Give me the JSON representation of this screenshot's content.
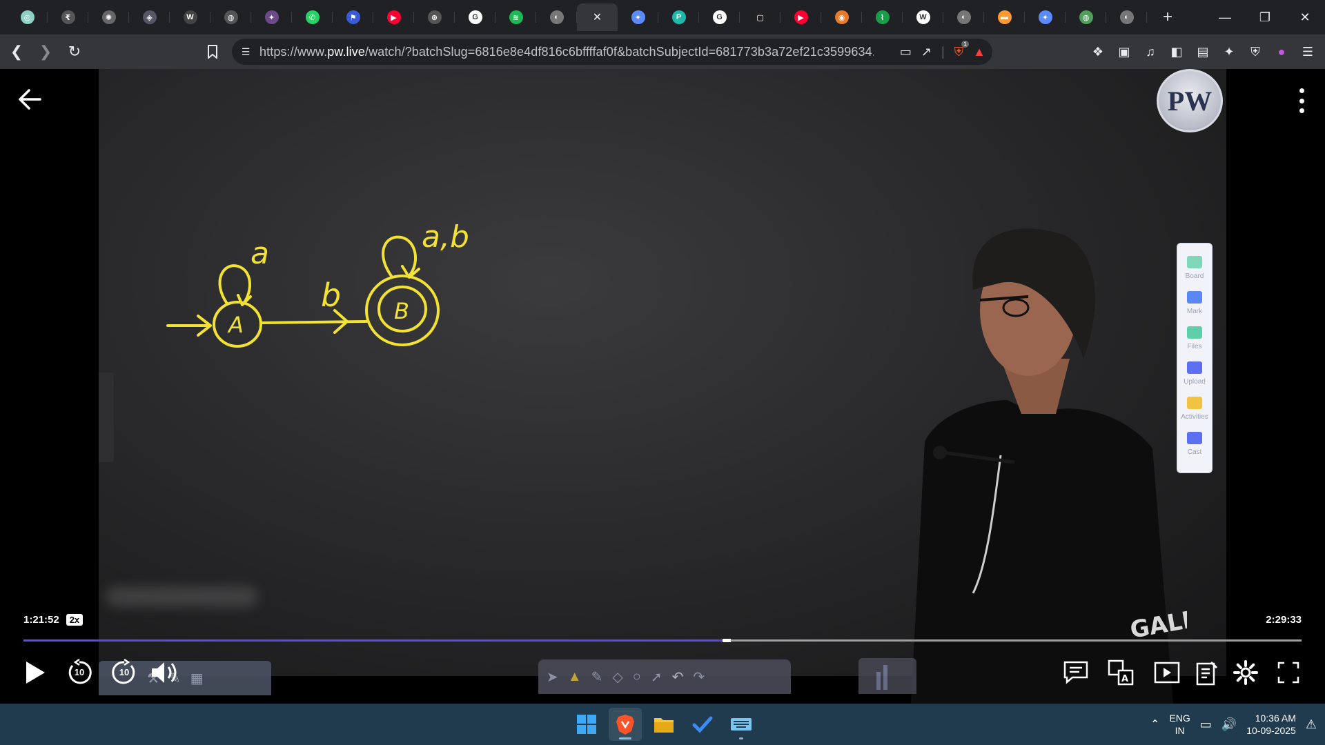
{
  "browser": {
    "tabs": [
      {
        "icon": "chatgpt-icon",
        "color": "#8fd0c4",
        "glyph": "◎"
      },
      {
        "icon": "coin-icon",
        "color": "#555",
        "glyph": "₹"
      },
      {
        "icon": "openai-icon",
        "color": "#666",
        "glyph": "✺"
      },
      {
        "icon": "game-icon",
        "color": "#556",
        "glyph": "◈"
      },
      {
        "icon": "wordpress-icon",
        "color": "#444",
        "glyph": "W"
      },
      {
        "icon": "grey-circle-icon",
        "color": "#555",
        "glyph": "◍"
      },
      {
        "icon": "purple-app-icon",
        "color": "#6b4a8a",
        "glyph": "✦"
      },
      {
        "icon": "whatsapp-icon",
        "color": "#25d366",
        "glyph": "✆"
      },
      {
        "icon": "bookmark-app-icon",
        "color": "#3b5bd6",
        "glyph": "⚑"
      },
      {
        "icon": "youtube-icon",
        "color": "#ff0033",
        "glyph": "▶"
      },
      {
        "icon": "nptel-icon",
        "color": "#555",
        "glyph": "⊛"
      },
      {
        "icon": "google-icon",
        "color": "#ffffff",
        "glyph": "G"
      },
      {
        "icon": "spotify-icon",
        "color": "#1db954",
        "glyph": "≋"
      },
      {
        "icon": "globe-icon",
        "color": "#777",
        "glyph": "◐"
      },
      {
        "icon": "active-tab-close-icon",
        "color": "",
        "glyph": "✕",
        "active": true
      },
      {
        "icon": "gemini-icon",
        "color": "#5b8cff",
        "glyph": "✦"
      },
      {
        "icon": "perplexity-icon",
        "color": "#20b8a8",
        "glyph": "P"
      },
      {
        "icon": "google-icon",
        "color": "#ffffff",
        "glyph": "G"
      },
      {
        "icon": "screen-icon",
        "color": "#222",
        "glyph": "▢"
      },
      {
        "icon": "youtube-icon",
        "color": "#ff0033",
        "glyph": "▶"
      },
      {
        "icon": "orange-globe-icon",
        "color": "#e87b2b",
        "glyph": "◉"
      },
      {
        "icon": "chart-app-icon",
        "color": "#1a9d4a",
        "glyph": "⌇"
      },
      {
        "icon": "wikipedia-icon",
        "color": "#ffffff",
        "glyph": "W"
      },
      {
        "icon": "globe-icon",
        "color": "#777",
        "glyph": "◐"
      },
      {
        "icon": "india-flag-icon",
        "color": "#ff9933",
        "glyph": "▬"
      },
      {
        "icon": "gemini-icon",
        "color": "#5b8cff",
        "glyph": "✦"
      },
      {
        "icon": "green-app-icon",
        "color": "#4f9e5a",
        "glyph": "◍"
      },
      {
        "icon": "globe-icon",
        "color": "#777",
        "glyph": "◐"
      }
    ],
    "url_prefix": "https://www.",
    "url_domain": "pw.live",
    "url_rest": "/watch/?batchSlug=6816e8e4df816c6bffffaf0f&batchSubjectId=681773b3a72ef21c3599634...",
    "brave_badge": "1"
  },
  "player": {
    "logo_text": "PW",
    "current_time": "1:21:52",
    "speed": "2x",
    "total_time": "2:29:33",
    "progress_fraction": 0.55,
    "skip_back_label": "10",
    "skip_fwd_label": "10",
    "board_drawing": {
      "state_a": "A",
      "state_b": "B",
      "loop_a_label": "a",
      "transition_label": "b",
      "loop_b_label": "a,b"
    },
    "side_panel": [
      {
        "label": "Board",
        "color": "#7fd6b9"
      },
      {
        "label": "Mark",
        "color": "#5b87f5"
      },
      {
        "label": "Files",
        "color": "#5fcfaa"
      },
      {
        "label": "Upload",
        "color": "#5b6ff0"
      },
      {
        "label": "Activities",
        "color": "#f2c243"
      },
      {
        "label": "Cast",
        "color": "#5b6ff0"
      }
    ]
  },
  "taskbar": {
    "lang_line1": "ENG",
    "lang_line2": "IN",
    "time": "10:36 AM",
    "date": "10-09-2025"
  }
}
